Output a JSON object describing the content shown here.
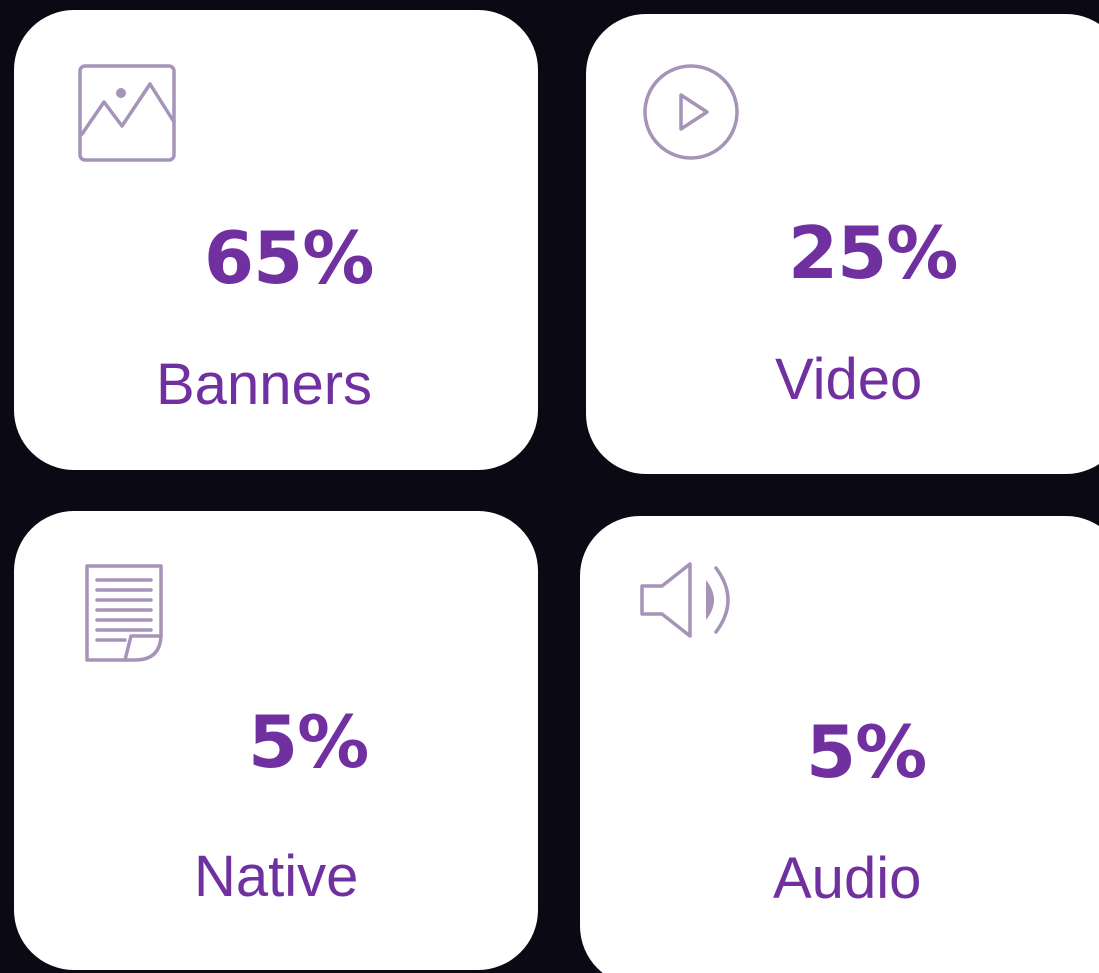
{
  "colors": {
    "background": "#0b0a14",
    "card": "#ffffff",
    "accent": "#7030a0",
    "icon": "#a593b8"
  },
  "cards": [
    {
      "percent": "65%",
      "label": "Banners",
      "icon": "image-icon"
    },
    {
      "percent": "25%",
      "label": "Video",
      "icon": "play-icon"
    },
    {
      "percent": "5%",
      "label": "Native",
      "icon": "document-icon"
    },
    {
      "percent": "5%",
      "label": "Audio",
      "icon": "speaker-icon"
    }
  ]
}
